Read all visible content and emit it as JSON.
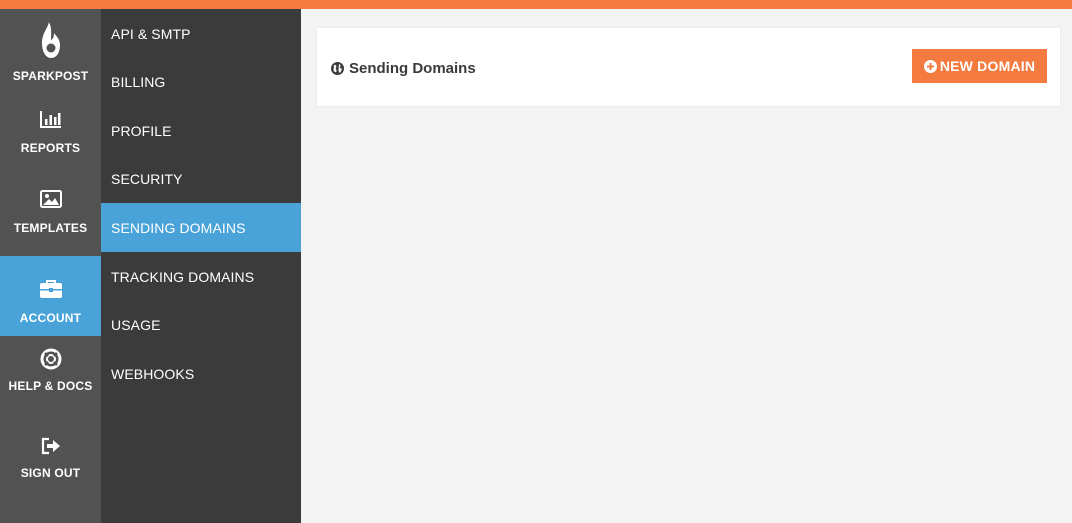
{
  "colors": {
    "accent_orange": "#f37b3f",
    "active_blue": "#4aa3d8",
    "primary_nav_bg": "#525252",
    "secondary_nav_bg": "#3b3b3b",
    "content_bg": "#f3f3f3"
  },
  "primary_nav": {
    "brand": {
      "label": "SPARKPOST",
      "icon": "flame-logo-icon"
    },
    "items": [
      {
        "label": "REPORTS",
        "icon": "bar-chart-icon",
        "active": false
      },
      {
        "label": "TEMPLATES",
        "icon": "image-icon",
        "active": false
      },
      {
        "label": "ACCOUNT",
        "icon": "briefcase-icon",
        "active": true
      },
      {
        "label": "HELP & DOCS",
        "icon": "life-ring-icon",
        "active": false
      },
      {
        "label": "SIGN OUT",
        "icon": "sign-out-icon",
        "active": false
      }
    ]
  },
  "secondary_nav": {
    "items": [
      {
        "label": "API & SMTP",
        "active": false
      },
      {
        "label": "BILLING",
        "active": false
      },
      {
        "label": "PROFILE",
        "active": false
      },
      {
        "label": "SECURITY",
        "active": false
      },
      {
        "label": "SENDING DOMAINS",
        "active": true
      },
      {
        "label": "TRACKING DOMAINS",
        "active": false
      },
      {
        "label": "USAGE",
        "active": false
      },
      {
        "label": "WEBHOOKS",
        "active": false
      }
    ]
  },
  "main": {
    "title": "Sending Domains",
    "title_icon": "globe-icon",
    "new_domain_button": {
      "label": "NEW DOMAIN",
      "icon": "plus-circle-icon"
    }
  }
}
